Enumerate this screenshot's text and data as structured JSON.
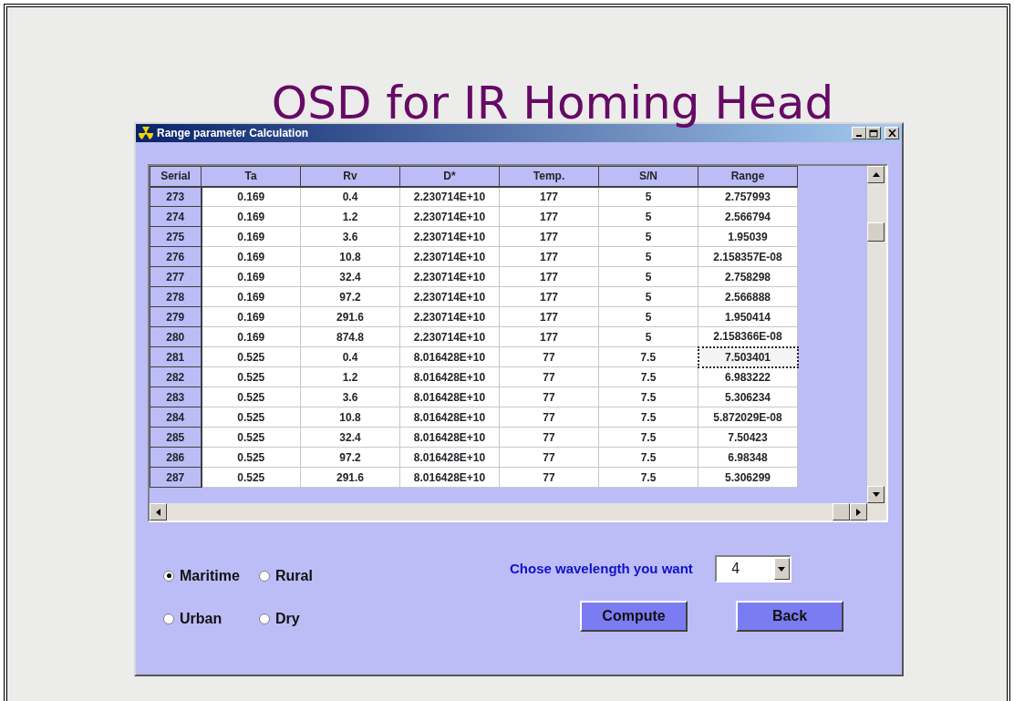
{
  "slide_title": "OSD for IR Homing Head",
  "window": {
    "title": "Range parameter Calculation"
  },
  "table": {
    "columns": [
      "Serial",
      "Ta",
      "Rv",
      "D*",
      "Temp.",
      "S/N",
      "Range"
    ],
    "rows": [
      {
        "cells": [
          "273",
          "0.169",
          "0.4",
          "2.230714E+10",
          "177",
          "5",
          "2.757993"
        ],
        "selected": false
      },
      {
        "cells": [
          "274",
          "0.169",
          "1.2",
          "2.230714E+10",
          "177",
          "5",
          "2.566794"
        ],
        "selected": false
      },
      {
        "cells": [
          "275",
          "0.169",
          "3.6",
          "2.230714E+10",
          "177",
          "5",
          "1.95039"
        ],
        "selected": false
      },
      {
        "cells": [
          "276",
          "0.169",
          "10.8",
          "2.230714E+10",
          "177",
          "5",
          "2.158357E-08"
        ],
        "selected": false
      },
      {
        "cells": [
          "277",
          "0.169",
          "32.4",
          "2.230714E+10",
          "177",
          "5",
          "2.758298"
        ],
        "selected": false
      },
      {
        "cells": [
          "278",
          "0.169",
          "97.2",
          "2.230714E+10",
          "177",
          "5",
          "2.566888"
        ],
        "selected": false
      },
      {
        "cells": [
          "279",
          "0.169",
          "291.6",
          "2.230714E+10",
          "177",
          "5",
          "1.950414"
        ],
        "selected": false
      },
      {
        "cells": [
          "280",
          "0.169",
          "874.8",
          "2.230714E+10",
          "177",
          "5",
          "2.158366E-08"
        ],
        "selected": false
      },
      {
        "cells": [
          "281",
          "0.525",
          "0.4",
          "8.016428E+10",
          "77",
          "7.5",
          "7.503401"
        ],
        "selected": true
      },
      {
        "cells": [
          "282",
          "0.525",
          "1.2",
          "8.016428E+10",
          "77",
          "7.5",
          "6.983222"
        ],
        "selected": false
      },
      {
        "cells": [
          "283",
          "0.525",
          "3.6",
          "8.016428E+10",
          "77",
          "7.5",
          "5.306234"
        ],
        "selected": false
      },
      {
        "cells": [
          "284",
          "0.525",
          "10.8",
          "8.016428E+10",
          "77",
          "7.5",
          "5.872029E-08"
        ],
        "selected": false
      },
      {
        "cells": [
          "285",
          "0.525",
          "32.4",
          "8.016428E+10",
          "77",
          "7.5",
          "7.50423"
        ],
        "selected": false
      },
      {
        "cells": [
          "286",
          "0.525",
          "97.2",
          "8.016428E+10",
          "77",
          "7.5",
          "6.98348"
        ],
        "selected": false
      },
      {
        "cells": [
          "287",
          "0.525",
          "291.6",
          "8.016428E+10",
          "77",
          "7.5",
          "5.306299"
        ],
        "selected": false
      }
    ]
  },
  "atmosphere": [
    {
      "label": "Maritime",
      "selected": true
    },
    {
      "label": "Rural",
      "selected": false
    },
    {
      "label": "Urban",
      "selected": false
    },
    {
      "label": "Dry",
      "selected": false
    }
  ],
  "wavelength": {
    "label": "Chose wavelength you want",
    "value": "4"
  },
  "buttons": [
    "Compute",
    "Back"
  ]
}
